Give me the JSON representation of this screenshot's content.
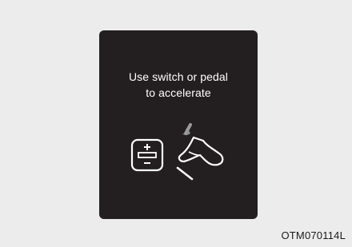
{
  "display": {
    "message_line1": "Use switch or pedal",
    "message_line2": "to accelerate"
  },
  "icons": {
    "switch": "accel-switch-icon",
    "pedal": "accelerator-pedal-icon"
  },
  "figure_code": "OTM070114L",
  "colors": {
    "background": "#ececec",
    "screen": "#231f20",
    "text": "#ffffff"
  }
}
